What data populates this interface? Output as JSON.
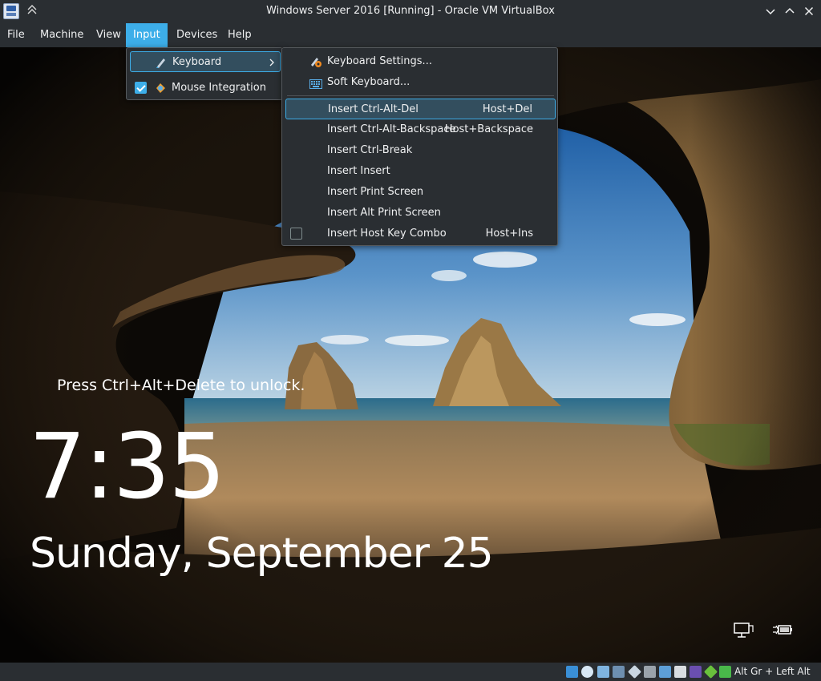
{
  "window": {
    "title": "Windows Server 2016 [Running] - Oracle VM VirtualBox",
    "app_icon": "virtualbox-icon",
    "keep_above_icon": "double-chevron-up-icon",
    "controls": [
      "minimize-icon",
      "maximize-icon",
      "close-icon"
    ]
  },
  "menubar": {
    "items": [
      {
        "label": "File"
      },
      {
        "label": "Machine"
      },
      {
        "label": "View"
      },
      {
        "label": "Input",
        "active": true
      },
      {
        "label": "Devices"
      },
      {
        "label": "Help"
      }
    ]
  },
  "input_menu": {
    "items": [
      {
        "label": "Keyboard",
        "icon": "keyboard-pen-icon",
        "submenu": true,
        "highlighted": true
      },
      {
        "label": "Mouse Integration",
        "icon": "mouse-integration-icon",
        "checked": true
      }
    ]
  },
  "keyboard_menu": {
    "items": [
      {
        "label": "Keyboard Settings...",
        "icon": "keyboard-settings-icon",
        "shortcut": ""
      },
      {
        "label": "Soft Keyboard...",
        "icon": "soft-keyboard-icon",
        "shortcut": ""
      },
      {
        "label": "Insert Ctrl-Alt-Del",
        "shortcut": "Host+Del",
        "highlighted": true
      },
      {
        "label": "Insert Ctrl-Alt-Backspace",
        "shortcut": "Host+Backspace"
      },
      {
        "label": "Insert Ctrl-Break",
        "shortcut": ""
      },
      {
        "label": "Insert Insert",
        "shortcut": ""
      },
      {
        "label": "Insert Print Screen",
        "shortcut": ""
      },
      {
        "label": "Insert Alt Print Screen",
        "shortcut": ""
      },
      {
        "label": "Insert Host Key Combo",
        "shortcut": "Host+Ins",
        "checkbox": true,
        "checked": false
      }
    ]
  },
  "lockscreen": {
    "prompt": "Press Ctrl+Alt+Delete to unlock.",
    "time": "7:35",
    "date": "Sunday, September 25",
    "icons": [
      "network-icon",
      "power-plug-icon"
    ]
  },
  "statusbar": {
    "icons": [
      "hard-disk-icon",
      "optical-drive-icon",
      "audio-icon",
      "network-adapter-icon",
      "usb-icon",
      "shared-folders-icon",
      "display-icon",
      "recording-icon",
      "virtualization-icon",
      "mouse-integration-icon",
      "arrow-down-icon"
    ],
    "host_key": "Alt Gr + Left Alt"
  },
  "colors": {
    "accent": "#3daee9",
    "window_bg": "#2a2e32",
    "highlight_bg": "#334e5e"
  }
}
